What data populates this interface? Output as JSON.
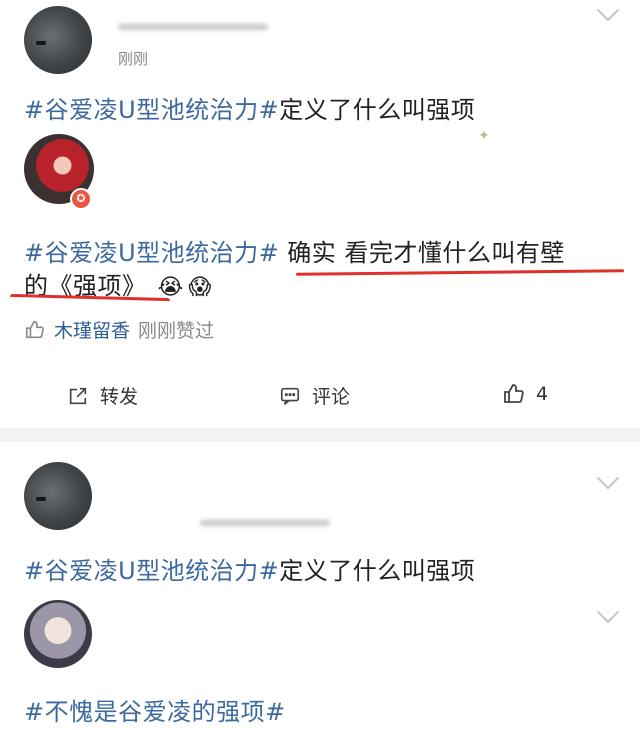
{
  "post1": {
    "time": "刚刚",
    "topic": "#谷爱凌U型池统治力#",
    "text": "定义了什么叫强项"
  },
  "repost": {
    "topic": "#谷爱凌U型池统治力#",
    "text_line1": "确实 看完才懂什么叫有壁",
    "text_line2": "的《强项》",
    "emoji1": "😭",
    "emoji2": "😱",
    "liker_name": "木瑾留香",
    "liked_status": "刚刚赞过"
  },
  "actions": {
    "share_label": "转发",
    "comment_label": "评论",
    "like_count": "4"
  },
  "post2": {
    "topic": "#谷爱凌U型池统治力#",
    "text": "定义了什么叫强项"
  },
  "post3": {
    "topic": "#不愧是谷爱凌的强项#"
  },
  "colors": {
    "topic": "#3d6a9e",
    "underline": "#e0302a",
    "background": "#ffffff",
    "divider": "#f2f2f2"
  }
}
